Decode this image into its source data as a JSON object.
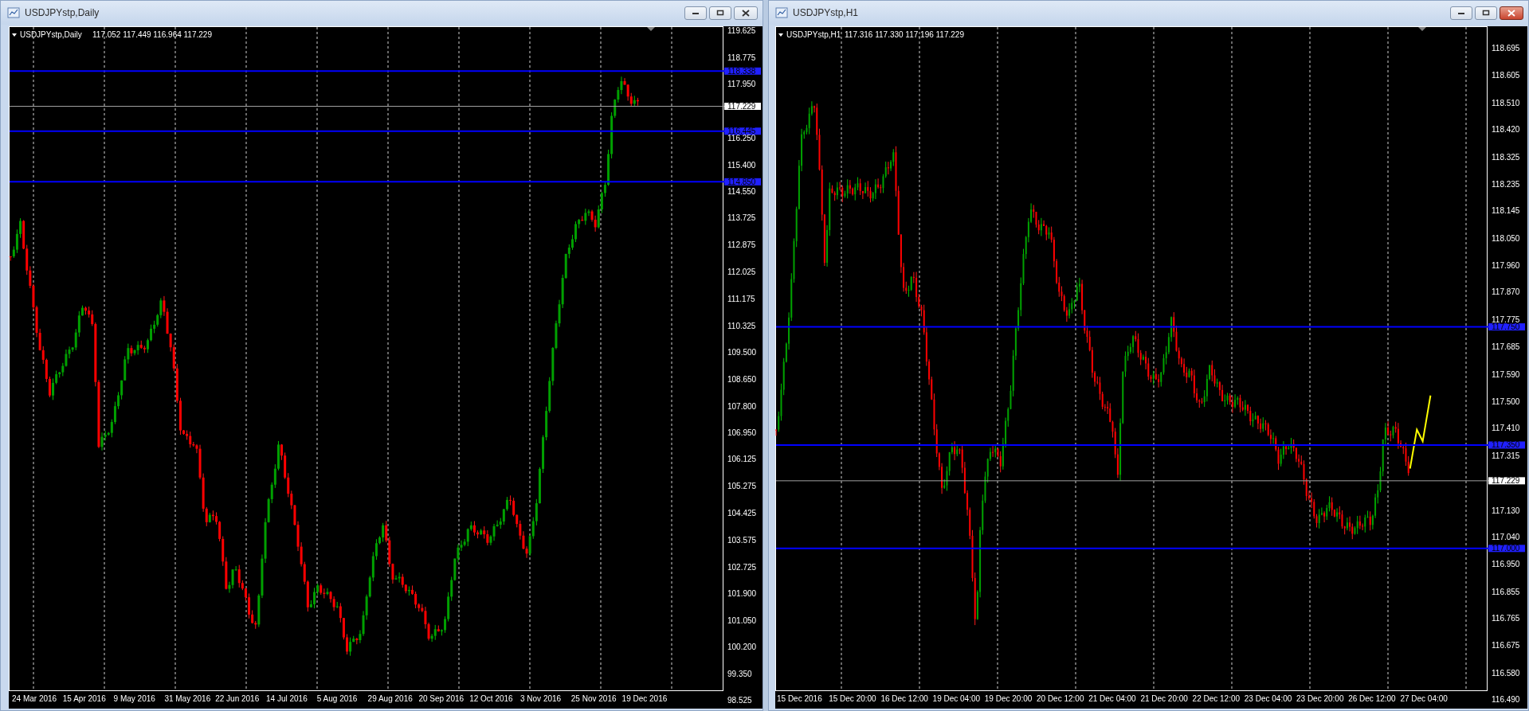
{
  "windows": [
    {
      "title": "USDJPYstp,Daily",
      "active": false,
      "chart": {
        "symbol": "USDJPYstp,Daily",
        "ohlc": "117.052 117.449 116.964 117.229",
        "price_ticks": [
          "119.625",
          "118.775",
          "117.950",
          "116.250",
          "115.400",
          "114.550",
          "113.725",
          "112.875",
          "112.025",
          "111.175",
          "110.325",
          "109.500",
          "108.650",
          "107.800",
          "106.950",
          "106.125",
          "105.275",
          "104.425",
          "103.575",
          "102.725",
          "101.900",
          "101.050",
          "100.200",
          "99.350",
          "98.525"
        ],
        "date_labels": [
          "24 Mar 2016",
          "15 Apr 2016",
          "9 May 2016",
          "31 May 2016",
          "22 Jun 2016",
          "14 Jul 2016",
          "5 Aug 2016",
          "29 Aug 2016",
          "20 Sep 2016",
          "12 Oct 2016",
          "3 Nov 2016",
          "25 Nov 2016",
          "19 Dec 2016"
        ],
        "levels": [
          {
            "kind": "line",
            "label": "118.338"
          },
          {
            "kind": "bid",
            "label": "117.229"
          },
          {
            "kind": "line",
            "label": "116.445"
          },
          {
            "kind": "line",
            "label": "114.850"
          }
        ]
      }
    },
    {
      "title": "USDJPYstp,H1",
      "active": true,
      "chart": {
        "symbol": "USDJPYstp,H1",
        "ohlc": "117.316 117.330 117.196 117.229",
        "price_ticks": [
          "118.695",
          "118.605",
          "118.510",
          "118.420",
          "118.325",
          "118.235",
          "118.145",
          "118.050",
          "117.960",
          "117.870",
          "117.775",
          "117.685",
          "117.590",
          "117.500",
          "117.410",
          "117.315",
          "117.130",
          "117.040",
          "116.950",
          "116.855",
          "116.765",
          "116.675",
          "116.580",
          "116.490"
        ],
        "date_labels": [
          "15 Dec 2016",
          "15 Dec 20:00",
          "16 Dec 12:00",
          "19 Dec 04:00",
          "19 Dec 20:00",
          "20 Dec 12:00",
          "21 Dec 04:00",
          "21 Dec 20:00",
          "22 Dec 12:00",
          "23 Dec 04:00",
          "23 Dec 20:00",
          "26 Dec 12:00",
          "27 Dec 04:00"
        ],
        "levels": [
          {
            "kind": "line",
            "label": "117.750"
          },
          {
            "kind": "line",
            "label": "117.350"
          },
          {
            "kind": "bid",
            "label": "117.229"
          },
          {
            "kind": "line",
            "label": "117.000"
          }
        ]
      }
    }
  ]
}
